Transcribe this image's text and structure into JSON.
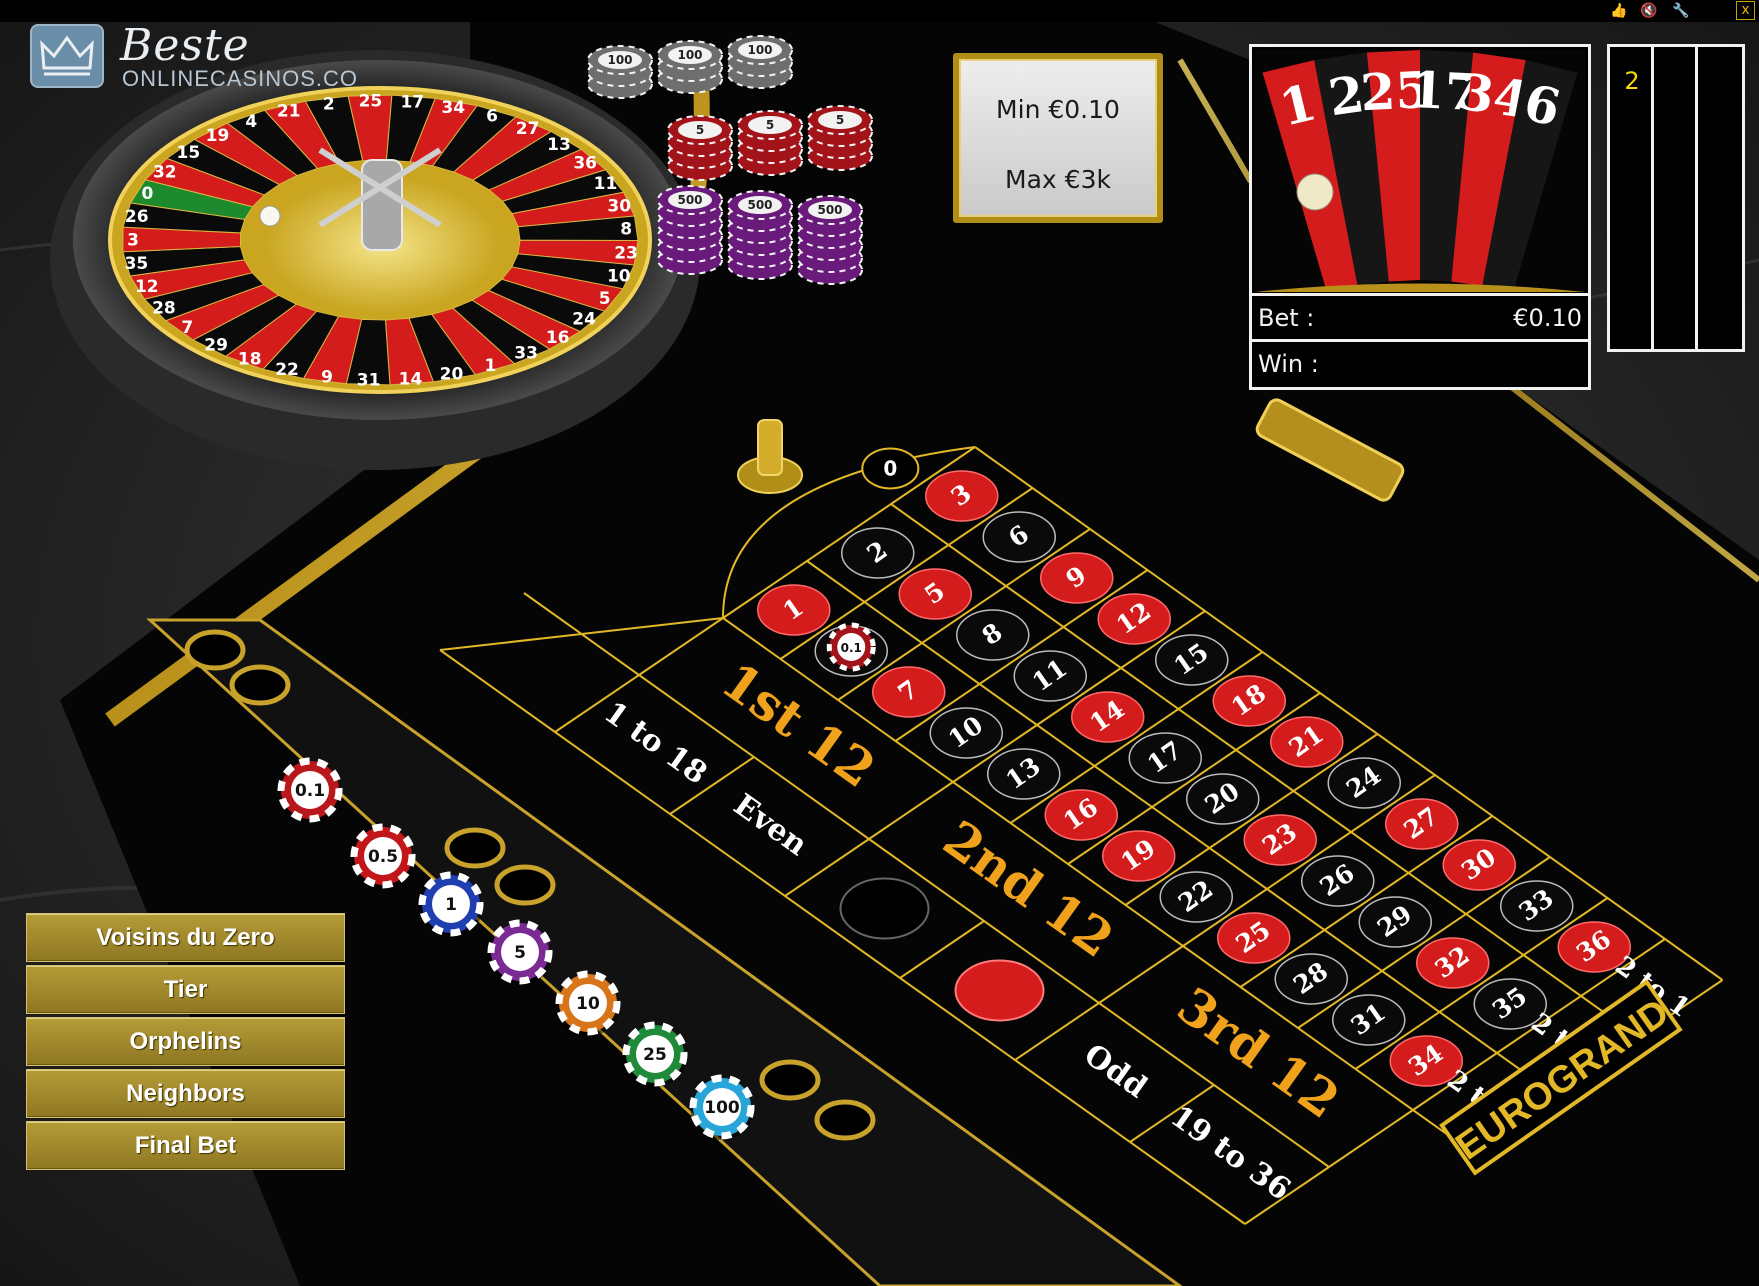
{
  "topbar": {
    "icons": [
      "thumbs-up-icon",
      "mute-icon",
      "wrench-icon"
    ],
    "close_label": "x"
  },
  "logo": {
    "title": "Beste",
    "subtitle": "ONLINECASINOS.CO"
  },
  "limits": {
    "min": "Min €0.10",
    "max": "Max €3k"
  },
  "result": {
    "wheel_numbers": [
      "1",
      "2",
      "25",
      "17",
      "34",
      "6"
    ],
    "bet_label": "Bet :",
    "bet_value": "€0.10",
    "win_label": "Win :",
    "win_value": ""
  },
  "history": [
    "2",
    "",
    ""
  ],
  "wheel": {
    "numbers": [
      "0",
      "32",
      "15",
      "19",
      "4",
      "21",
      "2",
      "25",
      "17",
      "34",
      "6",
      "27",
      "13",
      "36",
      "11",
      "30",
      "8",
      "23",
      "10",
      "5",
      "24",
      "16",
      "33",
      "1",
      "20",
      "14",
      "31",
      "9",
      "22",
      "18",
      "29",
      "7",
      "28",
      "12",
      "35",
      "3",
      "26"
    ]
  },
  "table": {
    "zero": "0",
    "rows": [
      [
        {
          "n": "3",
          "c": "red"
        },
        {
          "n": "6",
          "c": "black"
        },
        {
          "n": "9",
          "c": "red"
        },
        {
          "n": "12",
          "c": "red"
        },
        {
          "n": "15",
          "c": "black"
        },
        {
          "n": "18",
          "c": "red"
        },
        {
          "n": "21",
          "c": "red"
        },
        {
          "n": "24",
          "c": "black"
        },
        {
          "n": "27",
          "c": "red"
        },
        {
          "n": "30",
          "c": "red"
        },
        {
          "n": "33",
          "c": "black"
        },
        {
          "n": "36",
          "c": "red"
        }
      ],
      [
        {
          "n": "2",
          "c": "black"
        },
        {
          "n": "5",
          "c": "red"
        },
        {
          "n": "8",
          "c": "black"
        },
        {
          "n": "11",
          "c": "black"
        },
        {
          "n": "14",
          "c": "red"
        },
        {
          "n": "17",
          "c": "black"
        },
        {
          "n": "20",
          "c": "black"
        },
        {
          "n": "23",
          "c": "red"
        },
        {
          "n": "26",
          "c": "black"
        },
        {
          "n": "29",
          "c": "black"
        },
        {
          "n": "32",
          "c": "red"
        },
        {
          "n": "35",
          "c": "black"
        }
      ],
      [
        {
          "n": "1",
          "c": "red"
        },
        {
          "n": "4",
          "c": "black"
        },
        {
          "n": "7",
          "c": "red"
        },
        {
          "n": "10",
          "c": "black"
        },
        {
          "n": "13",
          "c": "black"
        },
        {
          "n": "16",
          "c": "red"
        },
        {
          "n": "19",
          "c": "red"
        },
        {
          "n": "22",
          "c": "black"
        },
        {
          "n": "25",
          "c": "red"
        },
        {
          "n": "28",
          "c": "black"
        },
        {
          "n": "31",
          "c": "black"
        },
        {
          "n": "34",
          "c": "red"
        }
      ]
    ],
    "columns": [
      "2 to 1",
      "2 to 1",
      "2 to 1"
    ],
    "dozens": [
      "1st 12",
      "2nd 12",
      "3rd 12"
    ],
    "outside": [
      "1 to 18",
      "Even",
      "",
      "",
      "Odd",
      "19 to 36"
    ],
    "placed_chip": {
      "label": "0.1",
      "on": "4"
    }
  },
  "chips": [
    {
      "label": "0.1",
      "color": "#b8171c"
    },
    {
      "label": "0.5",
      "color": "#c3161b"
    },
    {
      "label": "1",
      "color": "#1f3fb0"
    },
    {
      "label": "5",
      "color": "#7b2a93"
    },
    {
      "label": "10",
      "color": "#d8741a"
    },
    {
      "label": "25",
      "color": "#1f8a3a"
    },
    {
      "label": "100",
      "color": "#29a6d9"
    }
  ],
  "stack_labels": {
    "purple": "500",
    "red": "5",
    "gray": "100"
  },
  "callbets": [
    "Voisins du Zero",
    "Tier",
    "Orphelins",
    "Neighbors",
    "Final Bet"
  ],
  "brand": "EUROGRAND",
  "colors": {
    "red": "#d41c1c",
    "black": "#0a0a0a",
    "gold": "#e3b826",
    "felt": "#050505",
    "dozen_text": "#f0a21c"
  }
}
